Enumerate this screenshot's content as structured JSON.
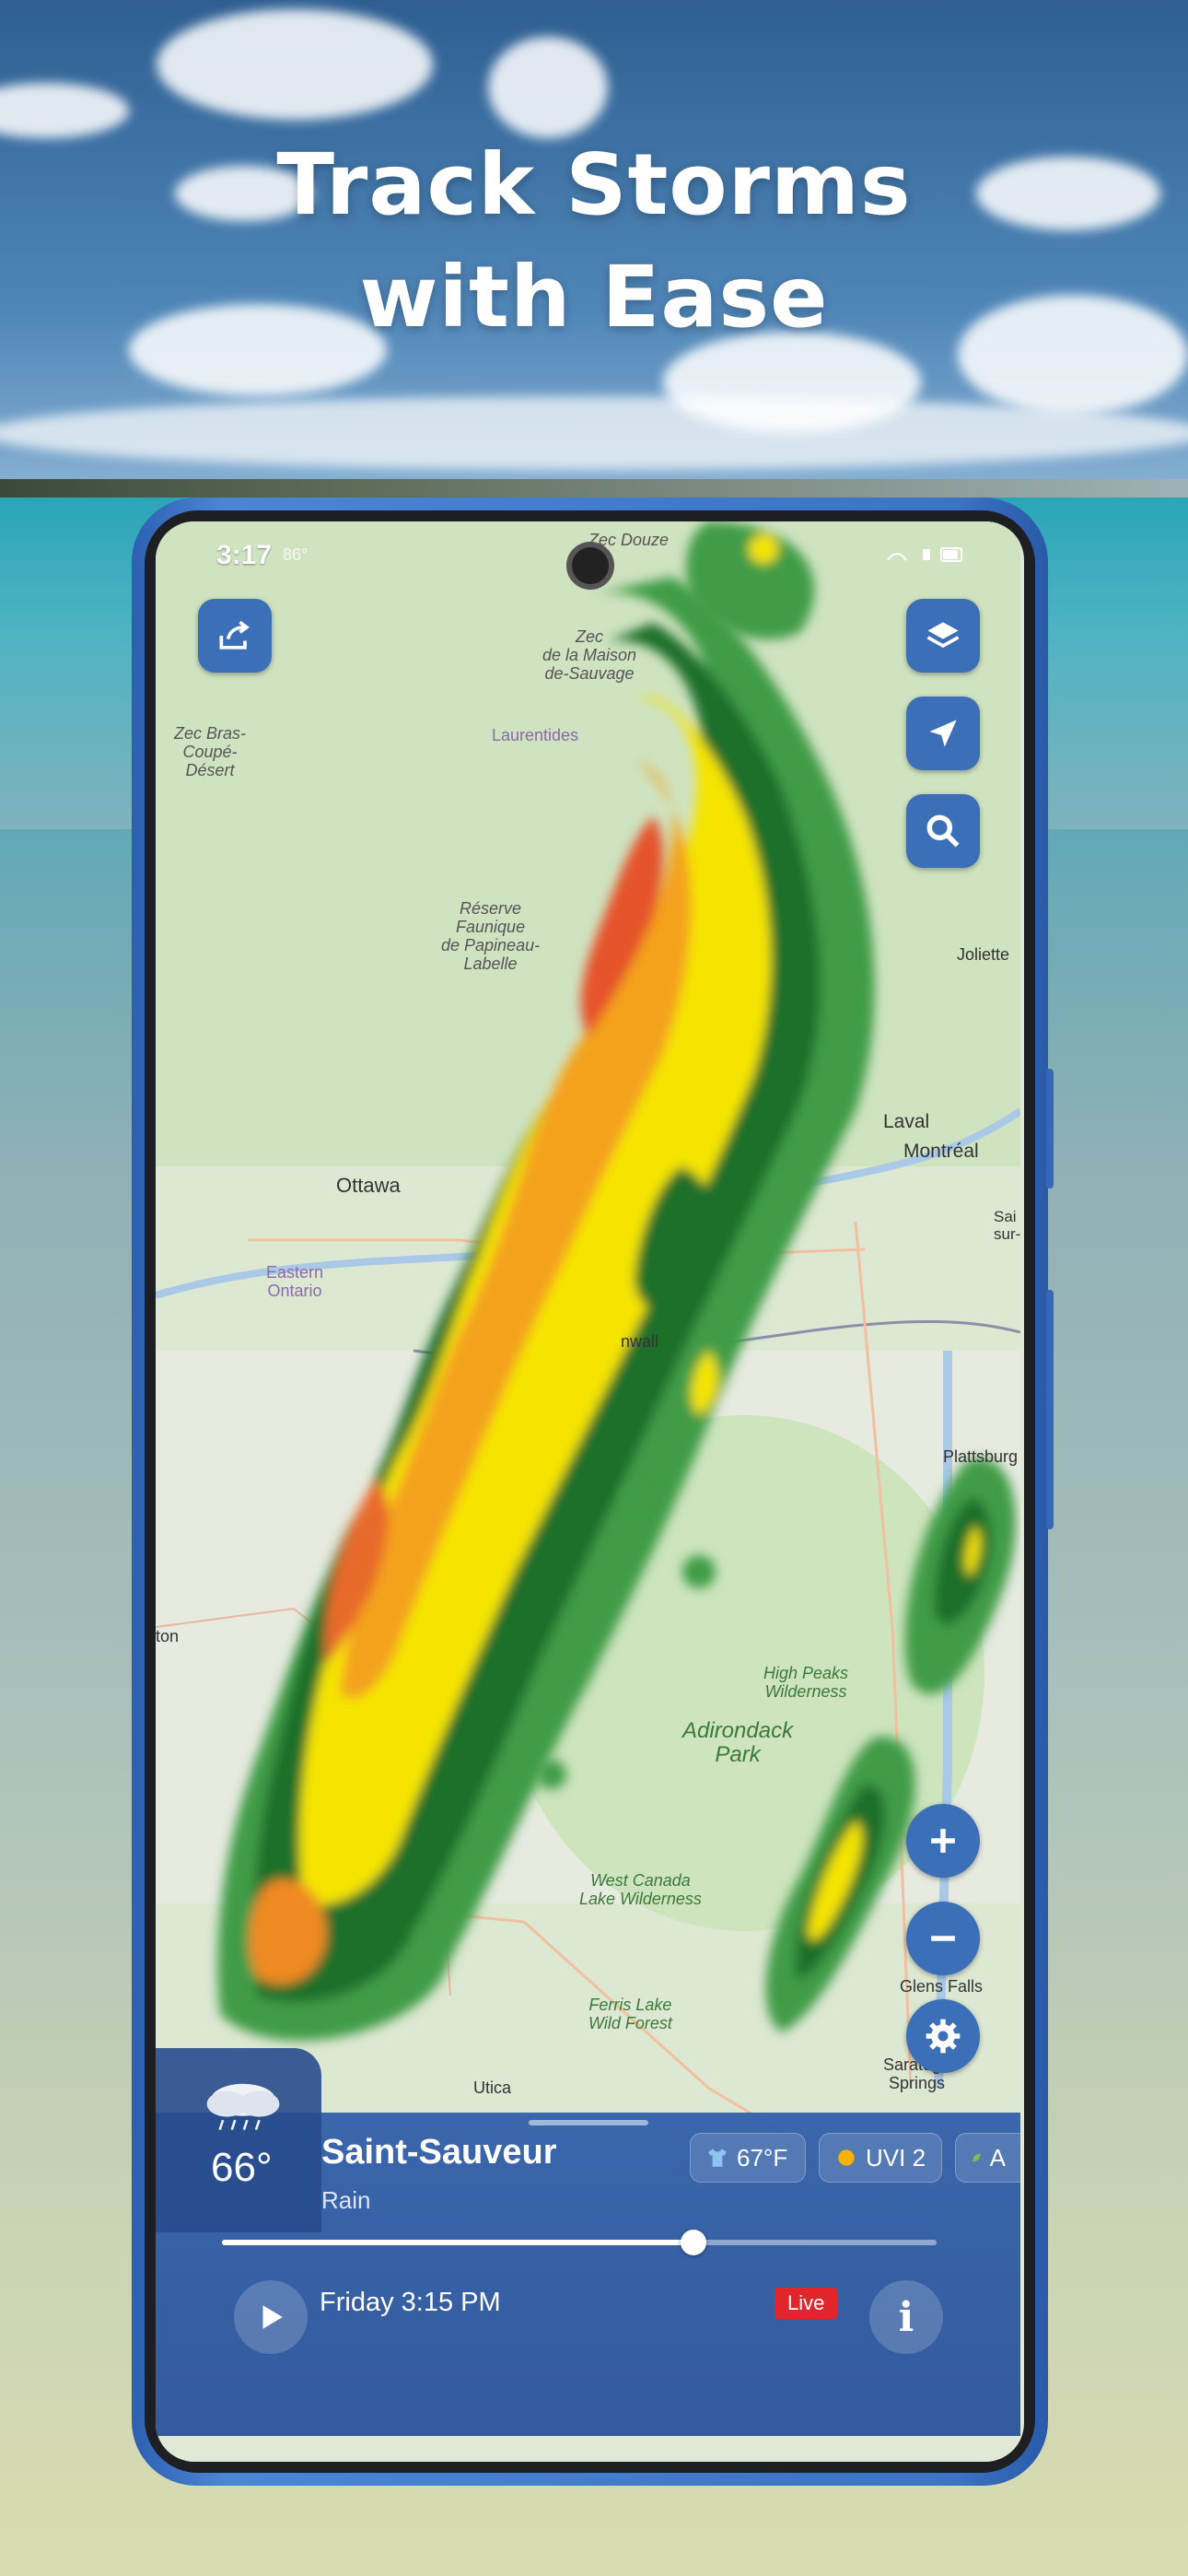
{
  "headline": {
    "line1": "Track Storms",
    "line2": "with Ease"
  },
  "status": {
    "time": "3:17",
    "temp": "86°"
  },
  "map_labels": {
    "laurentides": "Laurentides",
    "zec_douze": "Zec Douze",
    "zec_maison": "Zec\nde la Maison\nde-Sauvage",
    "zec_bras": "Zec Bras-\nCoupé-\nDésert",
    "reserve": "Réserve\nFaunique\nde Papineau-\nLabelle",
    "joliette": "Joliette",
    "laval": "Laval",
    "montreal": "Montréal",
    "ottawa": "Ottawa",
    "eastern_ontario": "Eastern\nOntario",
    "cornwall": "nwall",
    "plattsburgh": "Plattsburg",
    "high_peaks": "High Peaks\nWilderness",
    "adirondack": "Adirondack\nPark",
    "west_canada": "West Canada\nLake Wilderness",
    "ferris": "Ferris Lake\nWild Forest",
    "glens_falls": "Glens Falls",
    "saratoga": "Saratoga\nSprings",
    "utica": "Utica",
    "st_sur": "Sai\nsur-",
    "ton": "ton"
  },
  "panel": {
    "temperature": "66°",
    "location": "Saint-Sauveur",
    "condition": "Rain",
    "chip_feels": "67°F",
    "chip_uvi": "UVI 2",
    "chip_air": "A",
    "timestamp": "Friday 3:15 PM",
    "live_badge": "Live",
    "info_glyph": "i",
    "timeline_progress": 0.66
  },
  "icons": [
    "share-icon",
    "layers-icon",
    "locate-icon",
    "search-icon",
    "zoom-in-icon",
    "zoom-out-icon",
    "settings-icon",
    "rain-cloud-icon",
    "shirt-icon",
    "sun-icon",
    "leaf-icon",
    "play-icon",
    "info-icon"
  ],
  "colors": {
    "accent": "#3b6fb8",
    "live": "#e2242b",
    "panel": "#3562aa"
  }
}
